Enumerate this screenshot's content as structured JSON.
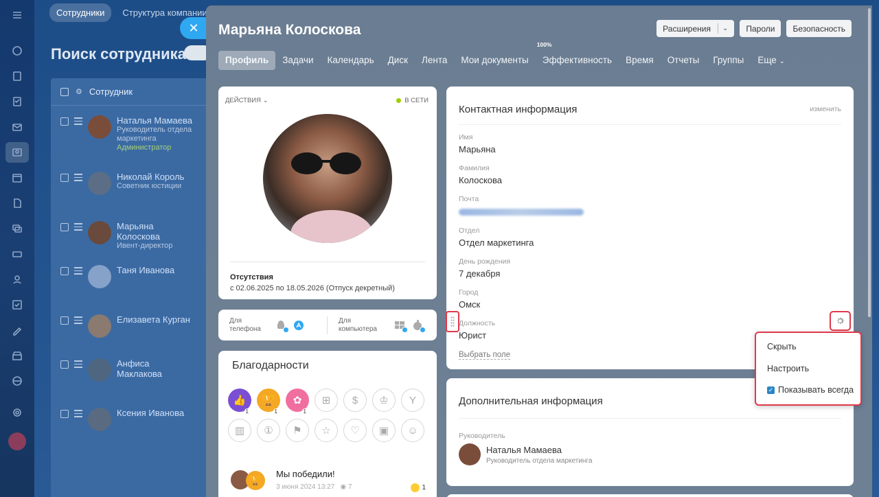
{
  "background_page": {
    "tabs": [
      "Сотрудники",
      "Структура компании"
    ],
    "title": "Поиск сотрудника",
    "list_header": "Сотрудник",
    "employees": [
      {
        "name": "Наталья Мамаева",
        "position": "Руководитель отдела маркетинга",
        "role": "Администратор"
      },
      {
        "name": "Николай Король",
        "position": "Советник юстиции",
        "role": ""
      },
      {
        "name": "Марьяна Колоскова",
        "position": "Ивент-директор",
        "role": ""
      },
      {
        "name": "Таня Иванова",
        "position": "",
        "role": ""
      },
      {
        "name": "Елизавета Курган",
        "position": "",
        "role": ""
      },
      {
        "name": "Анфиса Маклакова",
        "position": "",
        "role": ""
      },
      {
        "name": "Ксения Иванова",
        "position": "",
        "role": ""
      }
    ]
  },
  "panel": {
    "title": "Марьяна Колоскова",
    "header_buttons": {
      "extensions": "Расширения",
      "passwords": "Пароли",
      "security": "Безопасность"
    },
    "tabs": [
      "Профиль",
      "Задачи",
      "Календарь",
      "Диск",
      "Лента",
      "Мои документы",
      "Эффективность",
      "Время",
      "Отчеты",
      "Группы",
      "Еще"
    ],
    "efficiency_badge": "100%"
  },
  "profile_card": {
    "actions": "ДЕЙСТВИЯ",
    "status": "В СЕТИ",
    "absence_title": "Отсутствия",
    "absence_text": "с 02.06.2025 по 18.05.2026 (Отпуск декретный)"
  },
  "apps": {
    "phone_label": "Для телефона",
    "computer_label": "Для компьютера"
  },
  "thanks": {
    "title": "Благодарности",
    "badges": [
      {
        "icon": "thumbs-up-icon",
        "count": "1",
        "color": "#7b4fd3"
      },
      {
        "icon": "trophy-icon",
        "count": "1",
        "color": "#f4a823"
      },
      {
        "icon": "flower-icon",
        "count": "1",
        "color": "#f06fa0"
      },
      {
        "icon": "gift-icon",
        "count": ""
      },
      {
        "icon": "money-bag-icon",
        "count": ""
      },
      {
        "icon": "crown-icon",
        "count": ""
      },
      {
        "icon": "cocktail-icon",
        "count": ""
      },
      {
        "icon": "cake-icon",
        "count": ""
      },
      {
        "icon": "number-one-icon",
        "count": ""
      },
      {
        "icon": "flag-icon",
        "count": ""
      },
      {
        "icon": "star-icon",
        "count": ""
      },
      {
        "icon": "heart-icon",
        "count": ""
      },
      {
        "icon": "beer-icon",
        "count": ""
      },
      {
        "icon": "smile-icon",
        "count": ""
      }
    ],
    "post": {
      "title": "Мы победили!",
      "date": "3 июня 2024 13:27",
      "views": "7",
      "reactions": "1"
    }
  },
  "contact": {
    "title": "Контактная информация",
    "edit": "изменить",
    "fields": [
      {
        "label": "Имя",
        "value": "Марьяна"
      },
      {
        "label": "Фамилия",
        "value": "Колоскова"
      },
      {
        "label": "Почта",
        "value": ""
      },
      {
        "label": "Отдел",
        "value": "Отдел маркетинга"
      },
      {
        "label": "День рождения",
        "value": "7 декабря"
      },
      {
        "label": "Город",
        "value": "Омск"
      },
      {
        "label": "Должность",
        "value": "Юрист"
      }
    ],
    "select_field": "Выбрать поле"
  },
  "context_menu": {
    "hide": "Скрыть",
    "configure": "Настроить",
    "always_show": "Показывать всегда"
  },
  "extra": {
    "title": "Дополнительная информация",
    "manager_label": "Руководитель",
    "manager_name": "Наталья Мамаева",
    "manager_position": "Руководитель отдела маркетинга"
  }
}
